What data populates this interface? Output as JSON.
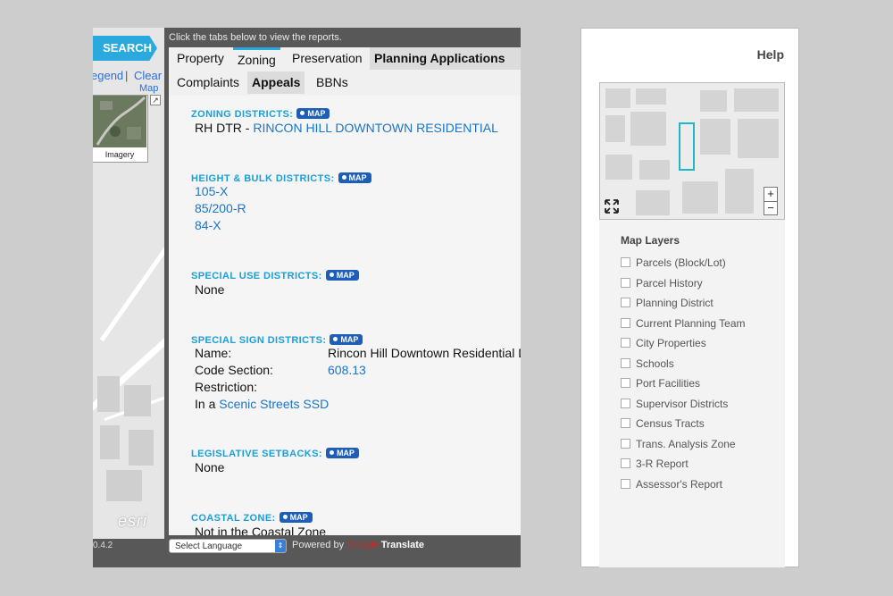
{
  "left_app": {
    "search_label": "SEARCH",
    "legend_link": "egend",
    "divider": "|",
    "clear_link": "Clear",
    "map_link": "Map",
    "imagery_label": "Imagery",
    "esri_logo": "esri",
    "version": "0.4.2",
    "instructions": "Click the tabs below to view the reports.",
    "tabs_row1": [
      "Property",
      "Zoning",
      "Preservation",
      "Planning Applications"
    ],
    "tabs_row2": [
      "Complaints",
      "Appeals",
      "BBNs"
    ],
    "active_tab": "Appeals",
    "map_button_label": "MAP",
    "report": {
      "zoning_districts": {
        "heading": "ZONING DISTRICTS:",
        "code": "RH DTR - ",
        "name": "RINCON HILL DOWNTOWN RESIDENTIAL"
      },
      "height_bulk": {
        "heading": "HEIGHT & BULK DISTRICTS:",
        "values": [
          "105-X",
          "85/200-R",
          "84-X"
        ]
      },
      "special_use": {
        "heading": "SPECIAL USE DISTRICTS:",
        "value": "None"
      },
      "special_sign": {
        "heading": "SPECIAL SIGN DISTRICTS:",
        "name_label": "Name:",
        "name_value": "Rincon Hill Downtown Residential D",
        "code_label": "Code Section:",
        "code_value": "608.13",
        "restriction_label": "Restriction:",
        "in_a": "In a ",
        "ssd_link": "Scenic Streets SSD"
      },
      "legislative_setbacks": {
        "heading": "LEGISLATIVE SETBACKS:",
        "value": "None"
      },
      "coastal_zone": {
        "heading": "COASTAL ZONE:",
        "value": "Not in the Coastal Zone"
      }
    },
    "footer": {
      "select_language": "Select Language",
      "powered_by": "Powered by ",
      "google": "Google",
      "translate": "Translate"
    }
  },
  "right_panel": {
    "help": "Help",
    "zoom_in": "+",
    "zoom_out": "−",
    "fullscreen_icon": "expand-icon",
    "map_layers_title": "Map Layers",
    "layers": [
      "Parcels (Block/Lot)",
      "Parcel History",
      "Planning District",
      "Current Planning Team",
      "City Properties",
      "Schools",
      "Port Facilities",
      "Supervisor Districts",
      "Census Tracts",
      "Trans. Analysis Zone",
      "3-R Report",
      "Assessor's Report"
    ],
    "accent_color": "#22b5c9"
  },
  "colors": {
    "background": "#cdcdcd",
    "brand_blue": "#29a9dd",
    "heading_blue": "#1a9fd9",
    "map_button": "#1d5fb8",
    "link_blue": "#1a74c9"
  }
}
